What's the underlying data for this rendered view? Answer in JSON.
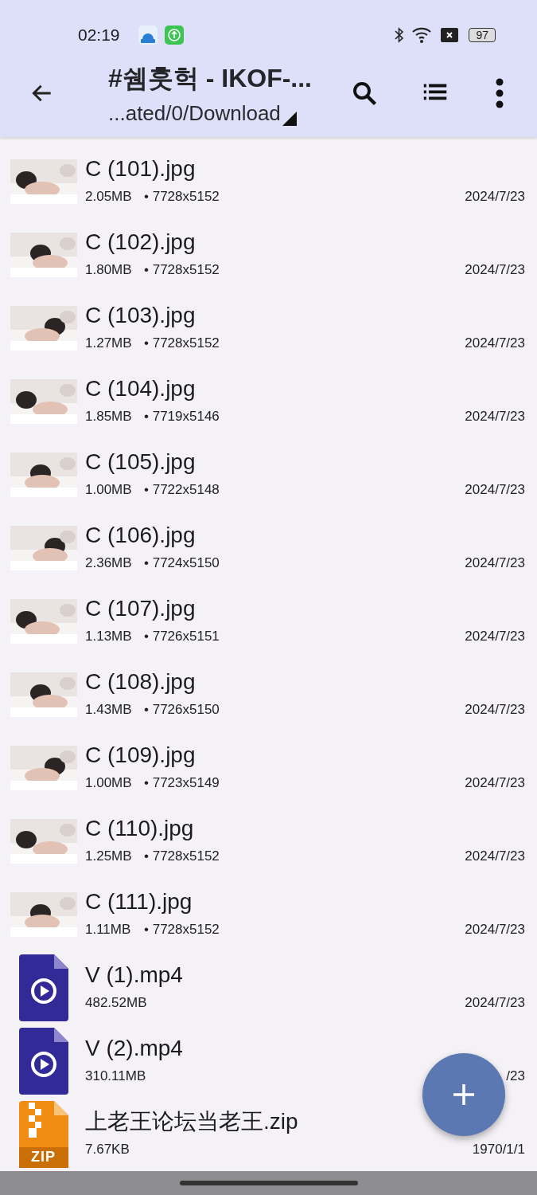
{
  "status_bar": {
    "time": "02:19",
    "battery": "97"
  },
  "header": {
    "title": "#쉠훗헉 - IKOF-...",
    "path": "...ated/0/Download"
  },
  "files": [
    {
      "name": "C (101).jpg",
      "size": "2.05MB",
      "dimensions": "• 7728x5152",
      "date": "2024/7/23"
    },
    {
      "name": "C (102).jpg",
      "size": "1.80MB",
      "dimensions": "• 7728x5152",
      "date": "2024/7/23"
    },
    {
      "name": "C (103).jpg",
      "size": "1.27MB",
      "dimensions": "• 7728x5152",
      "date": "2024/7/23"
    },
    {
      "name": "C (104).jpg",
      "size": "1.85MB",
      "dimensions": "• 7719x5146",
      "date": "2024/7/23"
    },
    {
      "name": "C (105).jpg",
      "size": "1.00MB",
      "dimensions": "• 7722x5148",
      "date": "2024/7/23"
    },
    {
      "name": "C (106).jpg",
      "size": "2.36MB",
      "dimensions": "• 7724x5150",
      "date": "2024/7/23"
    },
    {
      "name": "C (107).jpg",
      "size": "1.13MB",
      "dimensions": "• 7726x5151",
      "date": "2024/7/23"
    },
    {
      "name": "C (108).jpg",
      "size": "1.43MB",
      "dimensions": "• 7726x5150",
      "date": "2024/7/23"
    },
    {
      "name": "C (109).jpg",
      "size": "1.00MB",
      "dimensions": "• 7723x5149",
      "date": "2024/7/23"
    },
    {
      "name": "C (110).jpg",
      "size": "1.25MB",
      "dimensions": "• 7728x5152",
      "date": "2024/7/23"
    },
    {
      "name": "C (111).jpg",
      "size": "1.11MB",
      "dimensions": "• 7728x5152",
      "date": "2024/7/23"
    },
    {
      "kind": "video",
      "name": "V (1).mp4",
      "size": "482.52MB",
      "date": "2024/7/23"
    },
    {
      "kind": "video",
      "name": "V (2).mp4",
      "size": "310.11MB",
      "date": "/23"
    },
    {
      "kind": "zip",
      "name": "上老王论坛当老王.zip",
      "size": "7.67KB",
      "date": "1970/1/1",
      "icon_label": "ZIP"
    }
  ]
}
